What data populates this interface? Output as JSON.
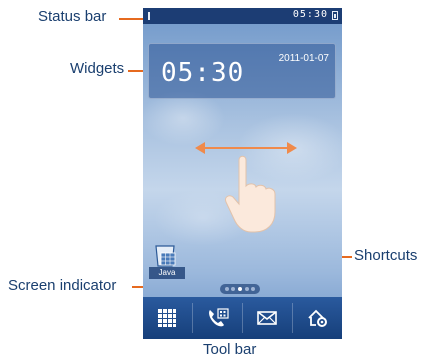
{
  "callouts": {
    "status_bar": "Status bar",
    "widgets": "Widgets",
    "shortcuts": "Shortcuts",
    "screen_indicator": "Screen indicator",
    "tool_bar": "Tool bar"
  },
  "status_bar": {
    "time": "05:30"
  },
  "widget": {
    "time": "05:30",
    "date": "2011-01-07"
  },
  "shortcut": {
    "label": "Java"
  },
  "screen_indicator": {
    "dots": 5,
    "active_index": 2
  },
  "toolbar": {
    "items": [
      "apps-icon",
      "contacts-call-icon",
      "messages-icon",
      "home-settings-icon"
    ]
  },
  "colors": {
    "callout_text": "#1a3f6f",
    "leader_line": "#e66a1f",
    "status_bar_bg": "#1c3d74",
    "toolbar_bg": "#163f7a"
  }
}
